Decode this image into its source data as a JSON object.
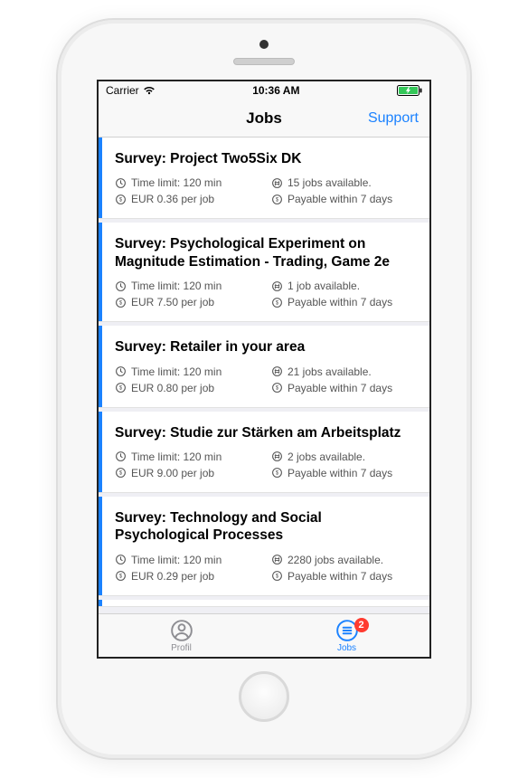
{
  "status": {
    "carrier": "Carrier",
    "time": "10:36 AM"
  },
  "navbar": {
    "title": "Jobs",
    "support": "Support"
  },
  "jobs": [
    {
      "title": "Survey: Project Two5Six DK",
      "time_limit": "Time limit: 120 min",
      "available": "15 jobs available.",
      "pay": "EUR 0.36 per job",
      "payable": "Payable within 7 days"
    },
    {
      "title": "Survey: Psychological Experiment on Magnitude Estimation - Trading, Game 2e",
      "time_limit": "Time limit: 120 min",
      "available": "1 job available.",
      "pay": "EUR 7.50 per job",
      "payable": "Payable within 7 days"
    },
    {
      "title": "Survey: Retailer in your area",
      "time_limit": "Time limit: 120 min",
      "available": "21 jobs available.",
      "pay": "EUR 0.80 per job",
      "payable": "Payable within 7 days"
    },
    {
      "title": "Survey: Studie zur Stärken am Arbeitsplatz",
      "time_limit": "Time limit: 120 min",
      "available": "2 jobs available.",
      "pay": "EUR 9.00 per job",
      "payable": "Payable within 7 days"
    },
    {
      "title": "Survey: Technology and Social Psychological Processes",
      "time_limit": "Time limit: 120 min",
      "available": "2280 jobs available.",
      "pay": "EUR 0.29 per job",
      "payable": "Payable within 7 days"
    }
  ],
  "tabs": {
    "profile": "Profil",
    "jobs": "Jobs",
    "badge": "2"
  }
}
